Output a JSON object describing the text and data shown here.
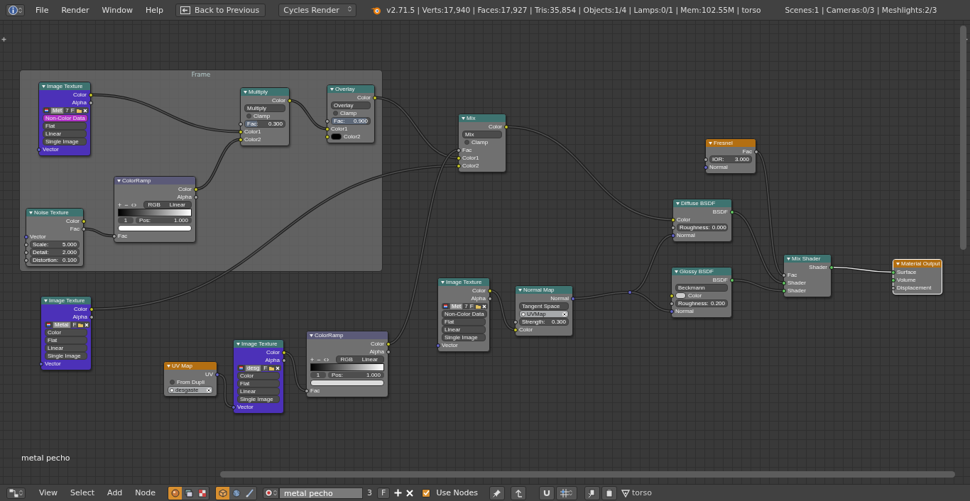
{
  "header": {
    "menus": [
      "File",
      "Render",
      "Window",
      "Help"
    ],
    "back_button": "Back to Previous",
    "engine": "Cycles Render",
    "stats": "v2.71.5 | Verts:17,940 | Faces:17,927 | Tris:35,854 | Objects:1/4 | Lamps:0/1 | Mem:102.55M | torso",
    "scene_stats": "Scenes:1 | Cameras:0/3 | Meshlights:2/3"
  },
  "frame": {
    "label": "Frame",
    "nodes": [
      {
        "title": "Image Texture",
        "kind": "texture",
        "color": "#4c31b8",
        "selected": false,
        "rows": [
          {
            "kind": "output",
            "label": "Color",
            "socket": {
              "kind": "color"
            }
          },
          {
            "kind": "output",
            "label": "Alpha",
            "socket": {
              "kind": "float"
            }
          },
          {
            "kind": "image",
            "name": "Met",
            "users": "7",
            "fake": "F"
          },
          {
            "kind": "dropdown",
            "value": "Non-Color Data",
            "active": true
          },
          {
            "kind": "dropdown",
            "value": "Flat",
            "active": false
          },
          {
            "kind": "dropdown",
            "value": "Linear",
            "active": false
          },
          {
            "kind": "dropdown",
            "value": "Single Image",
            "active": false
          },
          {
            "kind": "input",
            "label": "Vector",
            "socket": {
              "kind": "vector"
            }
          }
        ]
      },
      {
        "title": "Multiply",
        "kind": "color",
        "selected": false,
        "rows": [
          {
            "kind": "output",
            "label": "Color",
            "socket": {
              "kind": "color"
            }
          },
          {
            "kind": "dropdown",
            "value": "Multiply",
            "active": false
          },
          {
            "kind": "checkbox",
            "label": "Clamp",
            "checked": false
          },
          {
            "kind": "slider",
            "label": "Fac:",
            "value": "0.300",
            "level": 0.3,
            "socket": {
              "kind": "float"
            }
          },
          {
            "kind": "input",
            "label": "Color1",
            "socket": {
              "kind": "color"
            }
          },
          {
            "kind": "input",
            "label": "Color2",
            "socket": {
              "kind": "color"
            }
          }
        ]
      },
      {
        "title": "Overlay",
        "kind": "color",
        "selected": false,
        "rows": [
          {
            "kind": "output",
            "label": "Color",
            "socket": {
              "kind": "color"
            }
          },
          {
            "kind": "dropdown",
            "value": "Overlay",
            "active": false
          },
          {
            "kind": "checkbox",
            "label": "Clamp",
            "checked": false
          },
          {
            "kind": "slider",
            "label": "Fac:",
            "value": "0.900",
            "level": 0.9,
            "socket": {
              "kind": "float"
            }
          },
          {
            "kind": "input",
            "label": "Color1",
            "socket": {
              "kind": "color"
            }
          },
          {
            "kind": "swatch",
            "label": "Color2",
            "color": "#000000",
            "socket": {
              "kind": "color"
            }
          }
        ]
      },
      {
        "title": "ColorRamp",
        "kind": "converter",
        "selected": false,
        "rows": [
          {
            "kind": "output",
            "label": "Color",
            "socket": {
              "kind": "color"
            }
          },
          {
            "kind": "output",
            "label": "Alpha",
            "socket": {
              "kind": "float"
            }
          },
          {
            "kind": "ramp_controls",
            "add": "+",
            "remove": "−",
            "mode": "RGB",
            "interpolation": "Linear"
          },
          {
            "kind": "gradient"
          },
          {
            "kind": "stop",
            "index": "1",
            "label": "Pos:",
            "value": "1.000"
          },
          {
            "kind": "colorbar",
            "color": "#ffffff"
          },
          {
            "kind": "input",
            "label": "Fac",
            "socket": {
              "kind": "float"
            }
          }
        ]
      },
      {
        "title": "Noise Texture",
        "kind": "texture",
        "selected": false,
        "rows": [
          {
            "kind": "output",
            "label": "Color",
            "socket": {
              "kind": "color"
            }
          },
          {
            "kind": "output",
            "label": "Fac",
            "socket": {
              "kind": "float"
            }
          },
          {
            "kind": "input",
            "label": "Vector",
            "socket": {
              "kind": "vector"
            }
          },
          {
            "kind": "slider",
            "label": "Scale:",
            "value": "5.000",
            "socket": {
              "kind": "float"
            }
          },
          {
            "kind": "slider",
            "label": "Detail:",
            "value": "2.000",
            "socket": {
              "kind": "float"
            }
          },
          {
            "kind": "slider",
            "label": "Distortion:",
            "value": "0.100",
            "socket": {
              "kind": "float"
            }
          }
        ]
      }
    ]
  },
  "nodes": [
    {
      "title": "Mix",
      "kind": "color",
      "selected": false,
      "rows": [
        {
          "kind": "output",
          "label": "Color",
          "socket": {
            "kind": "color"
          }
        },
        {
          "kind": "dropdown",
          "value": "Mix",
          "active": false
        },
        {
          "kind": "checkbox",
          "label": "Clamp",
          "checked": false
        },
        {
          "kind": "input",
          "label": "Fac",
          "socket": {
            "kind": "float"
          }
        },
        {
          "kind": "input",
          "label": "Color1",
          "socket": {
            "kind": "color"
          }
        },
        {
          "kind": "input",
          "label": "Color2",
          "socket": {
            "kind": "color"
          }
        }
      ]
    },
    {
      "title": "Fresnel",
      "kind": "input",
      "selected": false,
      "rows": [
        {
          "kind": "output",
          "label": "Fac",
          "socket": {
            "kind": "float"
          }
        },
        {
          "kind": "slider",
          "label": "IOR:",
          "value": "3.000",
          "socket": {
            "kind": "float"
          }
        },
        {
          "kind": "input",
          "label": "Normal",
          "socket": {
            "kind": "vector"
          }
        }
      ]
    },
    {
      "title": "Diffuse BSDF",
      "kind": "shader",
      "selected": false,
      "rows": [
        {
          "kind": "output",
          "label": "BSDF",
          "socket": {
            "kind": "shader"
          }
        },
        {
          "kind": "input",
          "label": "Color",
          "socket": {
            "kind": "color"
          }
        },
        {
          "kind": "slider",
          "label": "Roughness:",
          "value": "0.000",
          "socket": {
            "kind": "float"
          }
        },
        {
          "kind": "input",
          "label": "Normal",
          "socket": {
            "kind": "vector"
          }
        }
      ]
    },
    {
      "title": "Glossy BSDF",
      "kind": "shader",
      "selected": false,
      "rows": [
        {
          "kind": "output",
          "label": "BSDF",
          "socket": {
            "kind": "shader"
          }
        },
        {
          "kind": "dropdown",
          "value": "Beckmann",
          "active": false
        },
        {
          "kind": "swatch",
          "label": "Color",
          "color": "#cccccc",
          "socket": {
            "kind": "color"
          }
        },
        {
          "kind": "slider",
          "label": "Roughness:",
          "value": "0.200",
          "socket": {
            "kind": "float"
          }
        },
        {
          "kind": "input",
          "label": "Normal",
          "socket": {
            "kind": "vector"
          }
        }
      ]
    },
    {
      "title": "Mix Shader",
      "kind": "shader",
      "selected": false,
      "rows": [
        {
          "kind": "output",
          "label": "Shader",
          "socket": {
            "kind": "shader"
          }
        },
        {
          "kind": "input",
          "label": "Fac",
          "socket": {
            "kind": "float"
          }
        },
        {
          "kind": "input",
          "label": "Shader",
          "socket": {
            "kind": "shader"
          }
        },
        {
          "kind": "input",
          "label": "Shader",
          "socket": {
            "kind": "shader"
          }
        }
      ]
    },
    {
      "title": "Material Output",
      "kind": "output",
      "selected": true,
      "rows": [
        {
          "kind": "input",
          "label": "Surface",
          "socket": {
            "kind": "shader"
          }
        },
        {
          "kind": "input",
          "label": "Volume",
          "socket": {
            "kind": "shader"
          }
        },
        {
          "kind": "input",
          "label": "Displacement",
          "socket": {
            "kind": "float"
          }
        }
      ]
    },
    {
      "title": "Image Texture",
      "kind": "texture",
      "selected": false,
      "rows": [
        {
          "kind": "output",
          "label": "Color",
          "socket": {
            "kind": "color"
          }
        },
        {
          "kind": "output",
          "label": "Alpha",
          "socket": {
            "kind": "float"
          }
        },
        {
          "kind": "image",
          "name": "Met",
          "users": "7",
          "fake": "F"
        },
        {
          "kind": "dropdown",
          "value": "Non-Color Data",
          "active": false
        },
        {
          "kind": "dropdown",
          "value": "Flat",
          "active": false
        },
        {
          "kind": "dropdown",
          "value": "Linear",
          "active": false
        },
        {
          "kind": "dropdown",
          "value": "Single Image",
          "active": false
        },
        {
          "kind": "input",
          "label": "Vector",
          "socket": {
            "kind": "vector"
          }
        }
      ]
    },
    {
      "title": "Normal Map",
      "kind": "vector",
      "selected": false,
      "rows": [
        {
          "kind": "output",
          "label": "Normal",
          "socket": {
            "kind": "vector"
          }
        },
        {
          "kind": "dropdown",
          "value": "Tangent Space",
          "active": false
        },
        {
          "kind": "uvfield",
          "value": "UVMap"
        },
        {
          "kind": "slider",
          "label": "Strength:",
          "value": "0.300",
          "socket": {
            "kind": "float"
          }
        },
        {
          "kind": "input",
          "label": "Color",
          "socket": {
            "kind": "color"
          }
        }
      ]
    },
    {
      "title": "Image Texture",
      "kind": "texture",
      "color": "#4c31b8",
      "selected": false,
      "rows": [
        {
          "kind": "output",
          "label": "Color",
          "socket": {
            "kind": "color"
          }
        },
        {
          "kind": "output",
          "label": "Alpha",
          "socket": {
            "kind": "float"
          }
        },
        {
          "kind": "image",
          "name": "Metal",
          "fake": "F"
        },
        {
          "kind": "dropdown",
          "value": "Color",
          "active": false
        },
        {
          "kind": "dropdown",
          "value": "Flat",
          "active": false
        },
        {
          "kind": "dropdown",
          "value": "Linear",
          "active": false
        },
        {
          "kind": "dropdown",
          "value": "Single Image",
          "active": false
        },
        {
          "kind": "input",
          "label": "Vector",
          "socket": {
            "kind": "vector"
          }
        }
      ]
    },
    {
      "title": "UV Map",
      "kind": "input",
      "selected": false,
      "rows": [
        {
          "kind": "output",
          "label": "UV",
          "socket": {
            "kind": "vector"
          }
        },
        {
          "kind": "checkbox",
          "label": "From Dupli",
          "checked": false
        },
        {
          "kind": "uvfield",
          "value": "desgaste"
        }
      ]
    },
    {
      "title": "Image Texture",
      "kind": "texture",
      "color": "#4c31b8",
      "selected": false,
      "rows": [
        {
          "kind": "output",
          "label": "Color",
          "socket": {
            "kind": "color"
          }
        },
        {
          "kind": "output",
          "label": "Alpha",
          "socket": {
            "kind": "float"
          }
        },
        {
          "kind": "image",
          "name": "desg",
          "fake": "F"
        },
        {
          "kind": "dropdown",
          "value": "Color",
          "active": false
        },
        {
          "kind": "dropdown",
          "value": "Flat",
          "active": false
        },
        {
          "kind": "dropdown",
          "value": "Linear",
          "active": false
        },
        {
          "kind": "dropdown",
          "value": "Single Image",
          "active": false
        },
        {
          "kind": "input",
          "label": "Vector",
          "socket": {
            "kind": "vector"
          }
        }
      ]
    },
    {
      "title": "ColorRamp",
      "kind": "converter",
      "selected": false,
      "rows": [
        {
          "kind": "output",
          "label": "Color",
          "socket": {
            "kind": "color"
          }
        },
        {
          "kind": "output",
          "label": "Alpha",
          "socket": {
            "kind": "float"
          }
        },
        {
          "kind": "ramp_controls",
          "add": "+",
          "remove": "−",
          "mode": "RGB",
          "interpolation": "Linear"
        },
        {
          "kind": "gradient"
        },
        {
          "kind": "stop",
          "index": "1",
          "label": "Pos:",
          "value": "1.000"
        },
        {
          "kind": "colorbar",
          "color": "#dcdcdc"
        },
        {
          "kind": "input",
          "label": "Fac",
          "socket": {
            "kind": "float"
          }
        }
      ]
    }
  ],
  "canvas_label": "metal pecho",
  "footer": {
    "menus": [
      "View",
      "Select",
      "Add",
      "Node"
    ],
    "tree_types": [
      {
        "kind": "shader",
        "selected": true
      },
      {
        "kind": "compositing",
        "selected": false
      },
      {
        "kind": "texture",
        "selected": false
      }
    ],
    "shader_sources": [
      {
        "kind": "object",
        "selected": true
      },
      {
        "kind": "world",
        "selected": false
      },
      {
        "kind": "line_style",
        "selected": false
      }
    ],
    "material": "metal pecho",
    "users": "3",
    "fake": "F",
    "use_nodes": {
      "label": "Use Nodes",
      "checked": true
    },
    "object": "torso"
  }
}
